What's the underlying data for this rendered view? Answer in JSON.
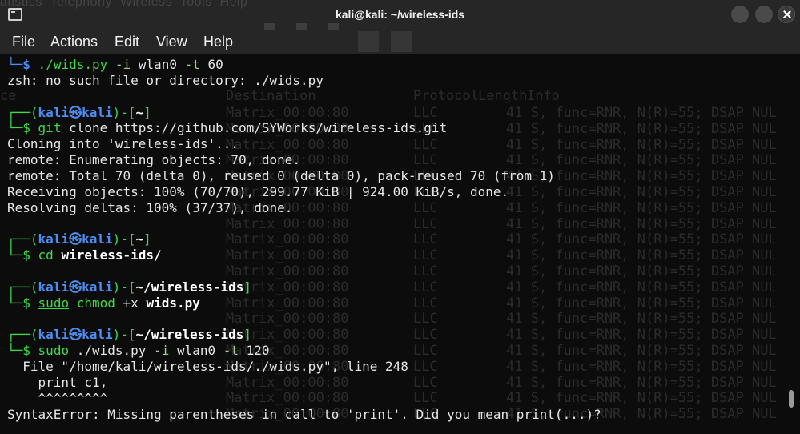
{
  "window": {
    "title": "kali@kali: ~/wireless-ids",
    "app_icon": "terminal-icon",
    "ghost_menu": "atistics  Telephony  Wireless  Tools  Help"
  },
  "menubar": {
    "items": [
      "File",
      "Actions",
      "Edit",
      "View",
      "Help"
    ]
  },
  "terminal": {
    "l0_cmd": "./wids.py",
    "l0_args": " -i",
    "l0_rest": " wlan0",
    "l0_rest2": " -t",
    "l0_rest3": " 60",
    "l1": "zsh: no such file or directory: ./wids.py",
    "prompt_user": "kali",
    "prompt_at": "㉿",
    "prompt_host": "kali",
    "home_dir": "~",
    "project_dir": "~/wireless-ids",
    "git_cmd": "git",
    "git_args": " clone https://github.com/SYWorks/wireless-ids.git",
    "out_clone": "Cloning into 'wireless-ids'...",
    "out_enum": "remote: Enumerating objects: 70, done.",
    "out_total": "remote: Total 70 (delta 0), reused 0 (delta 0), pack-reused 70 (from 1)",
    "out_recv": "Receiving objects: 100% (70/70), 299.77 KiB | 924.00 KiB/s, done.",
    "out_resolve": "Resolving deltas: 100% (37/37), done.",
    "cd_cmd": "cd",
    "cd_arg": "wireless-ids/",
    "sudo": "sudo",
    "chmod": "chmod",
    "chmod_flag": " +x",
    "chmod_file": "wids.py",
    "run_cmd": " ./wids.py",
    "run_i": " -i",
    "run_if": " wlan0",
    "run_t": " -t",
    "run_val": " 120",
    "err_file": "  File \"/home/kali/wireless-ids/./wids.py\", line 248",
    "err_code": "    print c1,",
    "err_caret": "    ^^^^^^^^^",
    "err_msg": "SyntaxError: Missing parentheses in call to 'print'. Did you mean print(...)?"
  },
  "background_capture": {
    "header": [
      "ce",
      "Destination",
      "Protocol",
      "Length",
      "Info"
    ],
    "row_dest": "Matrix_00:00:80",
    "row_proto": "LLC",
    "row_info": "41 S, func=RNR, N(R)=55; DSAP NUL"
  },
  "colors": {
    "terminal_bg": "#0c0c0c",
    "prompt_green": "#3fd94a",
    "prompt_blue": "#4f8df0",
    "text": "#e6e6e6"
  }
}
